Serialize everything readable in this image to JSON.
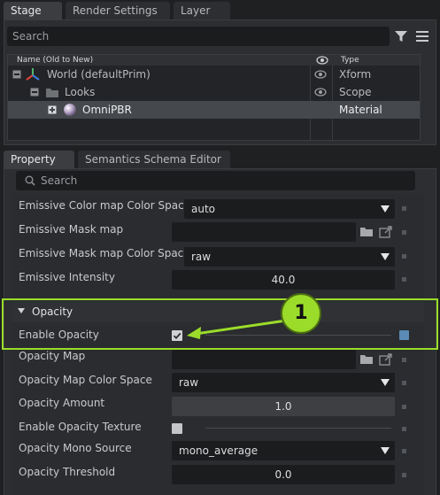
{
  "stage_tabs": [
    "Stage",
    "Render Settings",
    "Layer"
  ],
  "stage_search": {
    "placeholder": "Search"
  },
  "tree": {
    "headers": {
      "name": "Name (Old to New)",
      "type": "Type"
    },
    "rows": [
      {
        "name": "World (defaultPrim)",
        "type": "Xform"
      },
      {
        "name": "Looks",
        "type": "Scope"
      },
      {
        "name": "OmniPBR",
        "type": "Material"
      }
    ]
  },
  "property_tabs": [
    "Property",
    "Semantics Schema Editor"
  ],
  "property_search": {
    "placeholder": "Search"
  },
  "properties": {
    "emissive_color_space": {
      "label": "Emissive Color map Color Space",
      "value": "auto"
    },
    "emissive_mask_map": {
      "label": "Emissive Mask map",
      "value": ""
    },
    "emissive_mask_color_space": {
      "label": "Emissive Mask map Color Space",
      "value": "raw"
    },
    "emissive_intensity": {
      "label": "Emissive Intensity",
      "value": "40.0"
    },
    "opacity_section": "Opacity",
    "enable_opacity": {
      "label": "Enable Opacity",
      "checked": true
    },
    "opacity_map": {
      "label": "Opacity Map",
      "value": ""
    },
    "opacity_map_color_space": {
      "label": "Opacity Map Color Space",
      "value": "raw"
    },
    "opacity_amount": {
      "label": "Opacity Amount",
      "value": "1.0"
    },
    "enable_opacity_texture": {
      "label": "Enable Opacity Texture",
      "checked": false
    },
    "opacity_mono_source": {
      "label": "Opacity Mono Source",
      "value": "mono_average"
    },
    "opacity_threshold": {
      "label": "Opacity Threshold",
      "value": "0.0"
    }
  },
  "callout": {
    "number": "1",
    "color": "#9bdc2a"
  },
  "colors": {
    "accent": "#9bdc2a",
    "selection": "#45484c",
    "mixed_indicator": "#5a8ab5"
  }
}
